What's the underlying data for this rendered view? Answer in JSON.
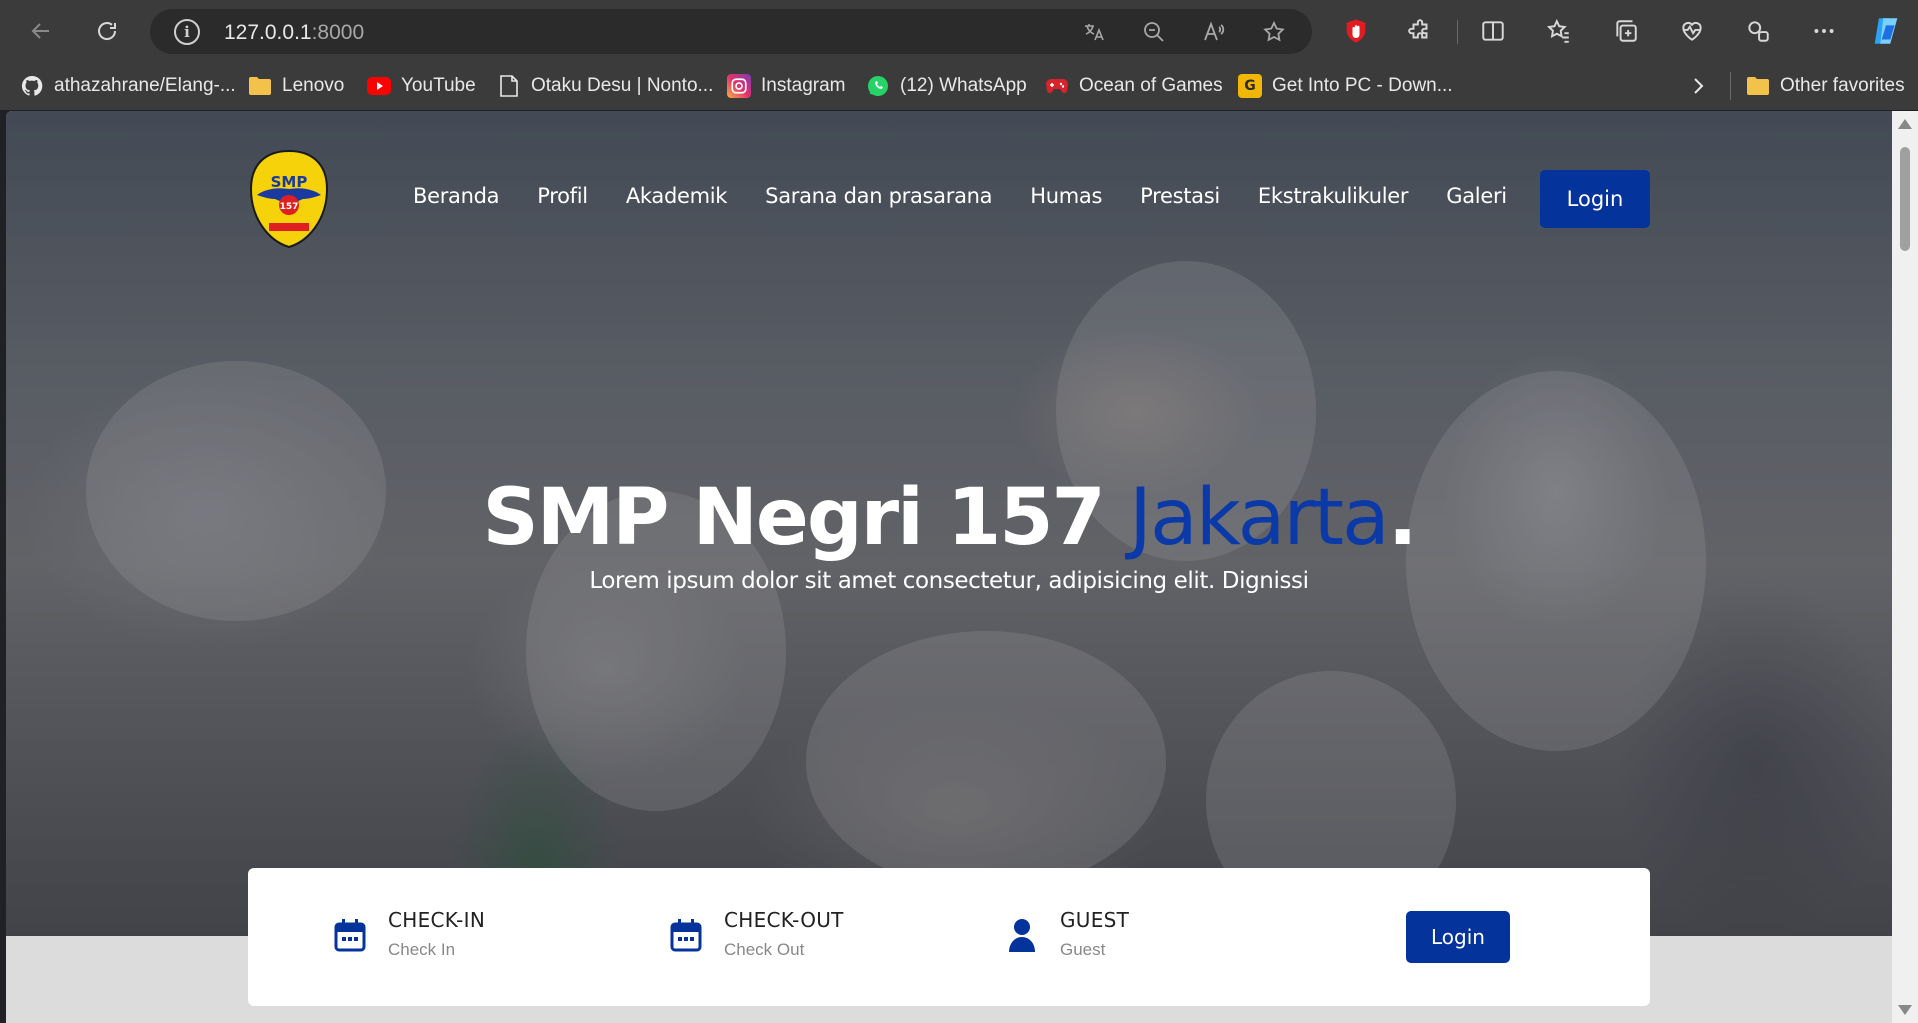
{
  "browser": {
    "url_host": "127.0.0.1",
    "url_port": ":8000",
    "bookmarks": [
      {
        "label": "athazahrane/Elang-...",
        "icon": "github-icon"
      },
      {
        "label": "Lenovo",
        "icon": "folder-icon"
      },
      {
        "label": "YouTube",
        "icon": "youtube-icon"
      },
      {
        "label": "Otaku Desu | Nonto...",
        "icon": "page-icon"
      },
      {
        "label": "Instagram",
        "icon": "instagram-icon"
      },
      {
        "label": "(12) WhatsApp",
        "icon": "whatsapp-icon"
      },
      {
        "label": "Ocean of Games",
        "icon": "gamepad-icon"
      },
      {
        "label": "Get Into PC - Down...",
        "icon": "getintopc-icon"
      }
    ],
    "other_favorites": "Other favorites"
  },
  "site": {
    "logo_text": "SMP",
    "logo_number": "157",
    "nav": [
      "Beranda",
      "Profil",
      "Akademik",
      "Sarana dan prasarana",
      "Humas",
      "Prestasi",
      "Ekstrakulikuler",
      "Galeri"
    ],
    "login_label": "Login",
    "hero": {
      "title_main": "SMP Negri 157 ",
      "title_accent": "Jakarta",
      "title_dot": ".",
      "subtitle": "Lorem ipsum dolor sit amet consectetur, adipisicing elit. Dignissi"
    },
    "booking": {
      "checkin_title": "CHECK-IN",
      "checkin_sub": "Check In",
      "checkout_title": "CHECK-OUT",
      "checkout_sub": "Check Out",
      "guest_title": "GUEST",
      "guest_sub": "Guest",
      "login_label": "Login"
    }
  },
  "colors": {
    "primary": "#05339c",
    "chrome": "#3b3b3b"
  }
}
